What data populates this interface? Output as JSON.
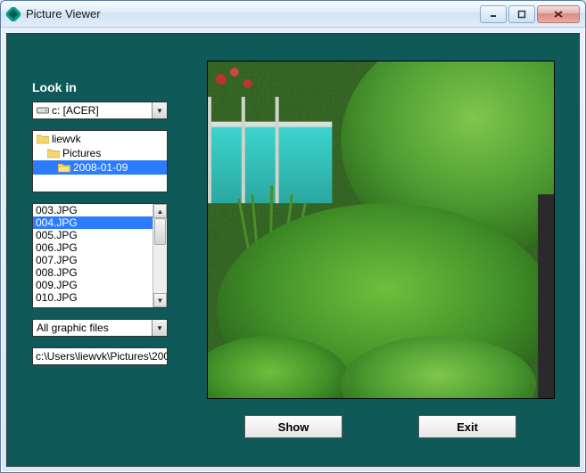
{
  "window": {
    "title": "Picture Viewer"
  },
  "lookin_label": "Look in",
  "drive": {
    "text": "c: [ACER]"
  },
  "folders": [
    {
      "name": "liewvk",
      "depth": 0,
      "selected": false
    },
    {
      "name": "Pictures",
      "depth": 1,
      "selected": false
    },
    {
      "name": "2008-01-09",
      "depth": 2,
      "selected": true
    }
  ],
  "files": [
    {
      "name": "003.JPG",
      "selected": false
    },
    {
      "name": "004.JPG",
      "selected": true
    },
    {
      "name": "005.JPG",
      "selected": false
    },
    {
      "name": "006.JPG",
      "selected": false
    },
    {
      "name": "007.JPG",
      "selected": false
    },
    {
      "name": "008.JPG",
      "selected": false
    },
    {
      "name": "009.JPG",
      "selected": false
    },
    {
      "name": "010.JPG",
      "selected": false
    }
  ],
  "filter": {
    "text": "All graphic files"
  },
  "path": {
    "value": "c:\\Users\\liewvk\\Pictures\\200"
  },
  "buttons": {
    "show": "Show",
    "exit": "Exit"
  }
}
